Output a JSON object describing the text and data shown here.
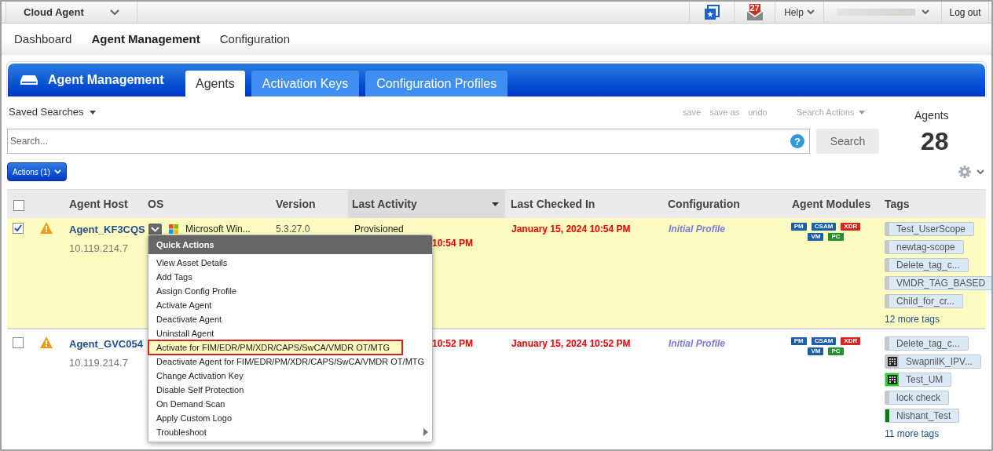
{
  "top_bar": {
    "app_name": "Cloud Agent",
    "notification_count": "27",
    "help": "Help",
    "logout": "Log out"
  },
  "nav": [
    {
      "label": "Dashboard",
      "selected": false
    },
    {
      "label": "Agent Management",
      "selected": true
    },
    {
      "label": "Configuration",
      "selected": false
    }
  ],
  "module_header": {
    "title": "Agent Management",
    "tabs": [
      {
        "label": "Agents",
        "selected": true
      },
      {
        "label": "Activation Keys",
        "selected": false
      },
      {
        "label": "Configuration Profiles",
        "selected": false
      }
    ]
  },
  "search": {
    "saved_searches": "Saved Searches",
    "links": [
      "save",
      "save as",
      "undo"
    ],
    "search_actions": "Search Actions",
    "placeholder": "Search...",
    "help_icon": "?",
    "button": "Search",
    "count_label": "Agents",
    "count": "28"
  },
  "actions_button": "Actions (1)",
  "table": {
    "select_all_checked": false,
    "columns": [
      "Agent Host",
      "OS",
      "Version",
      "Last Activity",
      "Last Checked In",
      "Configuration",
      "Agent Modules",
      "Tags"
    ],
    "rows": [
      {
        "checked": true,
        "host": "Agent_KF3CQS",
        "ip": "10.119.214.7",
        "os": "Microsoft Win...",
        "version": "5.3.27.0",
        "activity": "Provisioned",
        "activity_time": "10:54 PM",
        "checked_in": "January 15, 2024 10:54 PM",
        "configuration": "Initial Profile",
        "modules": [
          {
            "label": "PM",
            "color": "#1b5ea8"
          },
          {
            "label": "CSAM",
            "color": "#1b5ea8"
          },
          {
            "label": "XDR",
            "color": "#d8261f"
          },
          {
            "label": "VM",
            "color": "#1b5ea8"
          },
          {
            "label": "PC",
            "color": "#23902f"
          }
        ],
        "tags": [
          {
            "label": "Test_UserScope",
            "color": "#c8c8c8",
            "icon": false
          },
          {
            "label": "newtag-scope",
            "color": "#c8c8c8",
            "icon": false
          },
          {
            "label": "Delete_tag_c...",
            "color": "#c8c8c8",
            "icon": false
          },
          {
            "label": "VMDR_TAG_BASED",
            "color": "#c8c8c8",
            "icon": false
          },
          {
            "label": "Child_for_cr...",
            "color": "#c8c8c8",
            "icon": false
          }
        ],
        "more_tags": "12 more tags"
      },
      {
        "checked": false,
        "host": "Agent_GVC054",
        "ip": "10.119.214.7",
        "activity_time": "10:52 PM",
        "checked_in": "January 15, 2024 10:52 PM",
        "configuration": "Initial Profile",
        "modules": [
          {
            "label": "PM",
            "color": "#1b5ea8"
          },
          {
            "label": "CSAM",
            "color": "#1b5ea8"
          },
          {
            "label": "XDR",
            "color": "#d8261f"
          },
          {
            "label": "VM",
            "color": "#1b5ea8"
          },
          {
            "label": "PC",
            "color": "#23902f"
          }
        ],
        "tags": [
          {
            "label": "Delete_tag_c...",
            "color": "#c8c8c8",
            "icon": false
          },
          {
            "label": "SwapnilK_IPV...",
            "color": "#c8c8c8",
            "icon": true
          },
          {
            "label": "Test_UM",
            "color": "#11e011",
            "icon": true
          },
          {
            "label": "lock check",
            "color": "#c8c8c8",
            "icon": false
          },
          {
            "label": "Nishant_Test",
            "color": "#0a7a0a",
            "icon": false
          }
        ],
        "more_tags": "11 more tags"
      }
    ]
  },
  "quick_actions": {
    "title": "Quick Actions",
    "items": [
      {
        "label": "View Asset Details",
        "selected": false,
        "submenu": false
      },
      {
        "label": "Add Tags",
        "selected": false,
        "submenu": false
      },
      {
        "label": "Assign Config Profile",
        "selected": false,
        "submenu": false
      },
      {
        "label": "Activate Agent",
        "selected": false,
        "submenu": false
      },
      {
        "label": "Deactivate Agent",
        "selected": false,
        "submenu": false
      },
      {
        "label": "Uninstall Agent",
        "selected": false,
        "submenu": false
      },
      {
        "label": "Activate for FIM/EDR/PM/XDR/CAPS/SwCA/VMDR OT/MTG",
        "selected": true,
        "submenu": false
      },
      {
        "label": "Deactivate Agent for FIM/EDR/PM/XDR/CAPS/SwCA/VMDR OT/MTG",
        "selected": false,
        "submenu": false
      },
      {
        "label": "Change Activation Key",
        "selected": false,
        "submenu": false
      },
      {
        "label": "Disable Self Protection",
        "selected": false,
        "submenu": false
      },
      {
        "label": "On Demand Scan",
        "selected": false,
        "submenu": false
      },
      {
        "label": "Apply Custom Logo",
        "selected": false,
        "submenu": false
      },
      {
        "label": "Troubleshoot",
        "selected": false,
        "submenu": true
      }
    ]
  }
}
